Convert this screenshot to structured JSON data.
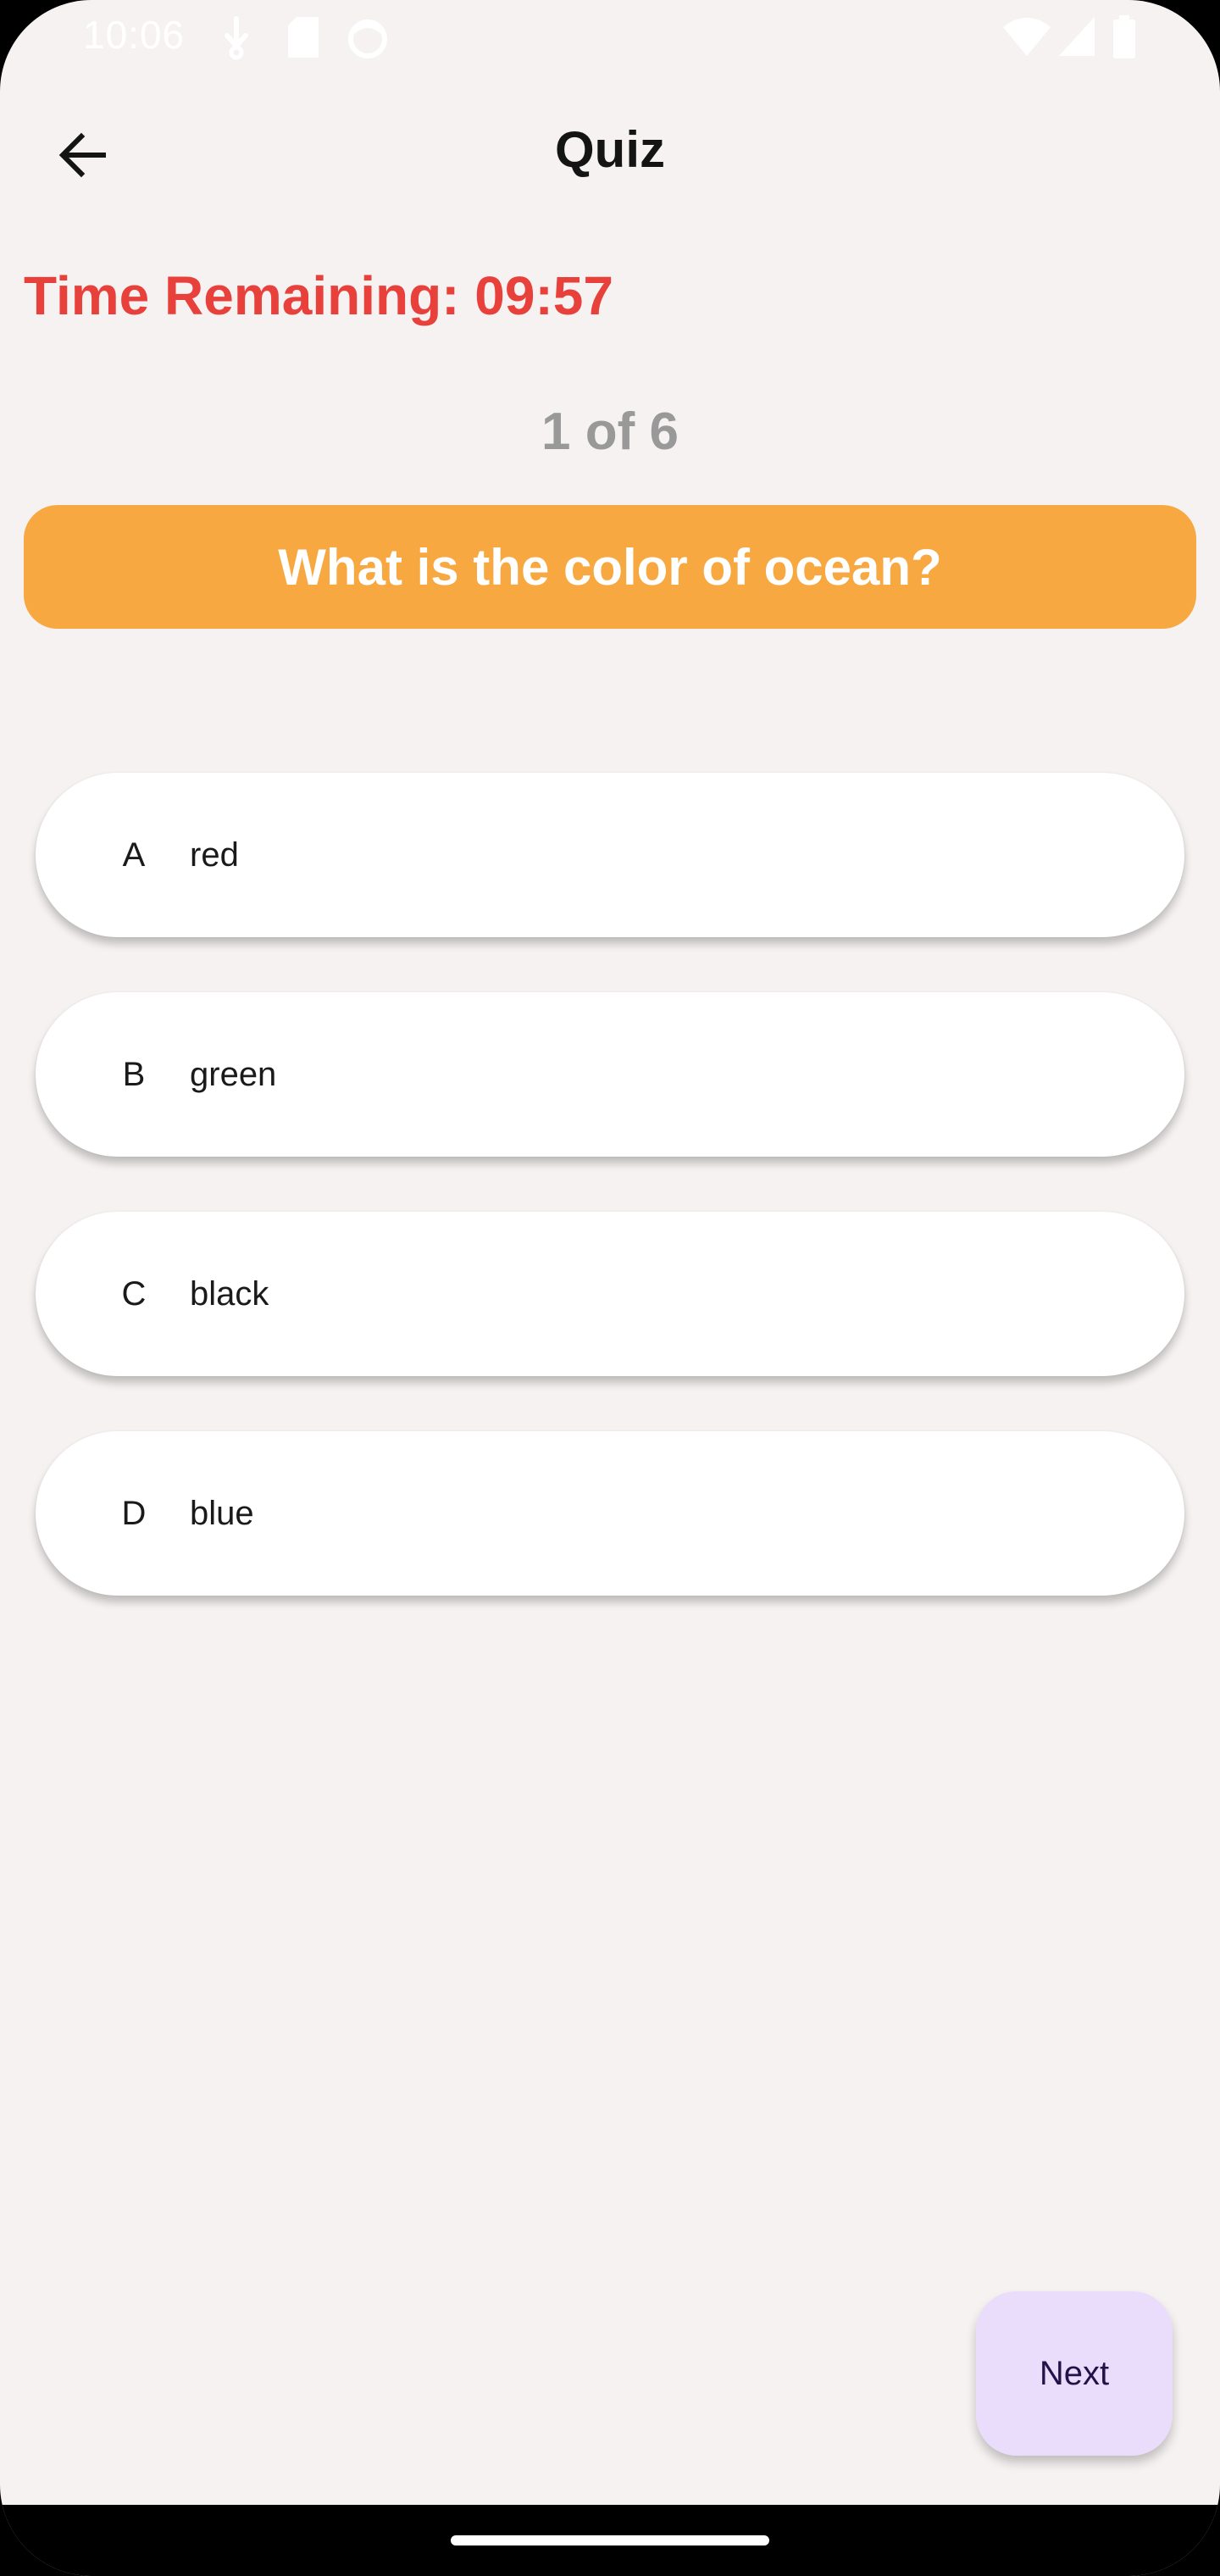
{
  "status_bar": {
    "time": "10:06",
    "icons_left": [
      "download-icon",
      "sd-card-icon",
      "face-icon"
    ],
    "icons_right": [
      "wifi-icon",
      "signal-icon",
      "battery-icon"
    ]
  },
  "app_bar": {
    "back_icon": "arrow-back-icon",
    "title": "Quiz"
  },
  "timer": {
    "text": "Time Remaining: 09:57",
    "color": "#e8403a"
  },
  "progress": {
    "text": "1 of 6",
    "current": 1,
    "total": 6
  },
  "question": {
    "text": "What is the color of ocean?",
    "background": "#f8a840"
  },
  "options": [
    {
      "letter": "A",
      "text": "red"
    },
    {
      "letter": "B",
      "text": "green"
    },
    {
      "letter": "C",
      "text": "black"
    },
    {
      "letter": "D",
      "text": "blue"
    }
  ],
  "next_button": {
    "label": "Next",
    "background": "#eaddfc"
  }
}
